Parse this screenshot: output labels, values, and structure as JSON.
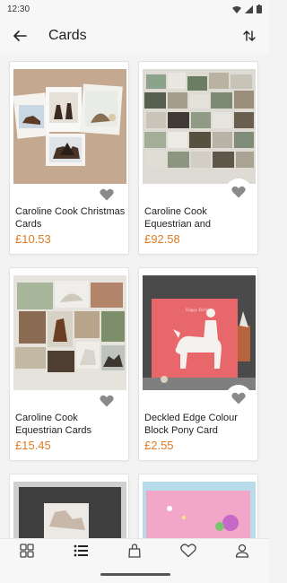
{
  "status": {
    "time": "12:30"
  },
  "app_bar": {
    "title": "Cards"
  },
  "products": [
    {
      "name": "Caroline Cook Christmas Cards",
      "price": "£10.53",
      "image": "christmas-horse-cards",
      "favorite_style": "plain"
    },
    {
      "name": "Caroline Cook Equestrian and",
      "price": "£92.58",
      "image": "equestrian-collage-cards",
      "favorite_style": "chip"
    },
    {
      "name": "Caroline Cook Equestrian Cards",
      "price": "£15.45",
      "image": "equestrian-cards-spread",
      "favorite_style": "plain"
    },
    {
      "name": "Deckled Edge Colour Block Pony Card",
      "price": "£2.55",
      "image": "pink-pony-card",
      "favorite_style": "chip",
      "image_text": "Happy Birthday"
    },
    {
      "name": "",
      "price": "",
      "image": "grey-card-partial"
    },
    {
      "name": "",
      "price": "",
      "image": "pink-birthday-card-partial"
    }
  ],
  "nav": [
    "grid-icon",
    "list-icon",
    "bag-icon",
    "heart-icon",
    "person-icon"
  ],
  "colors": {
    "price": "#e07b22",
    "background": "#f3f3f3",
    "pony_card": "#e8676a"
  }
}
